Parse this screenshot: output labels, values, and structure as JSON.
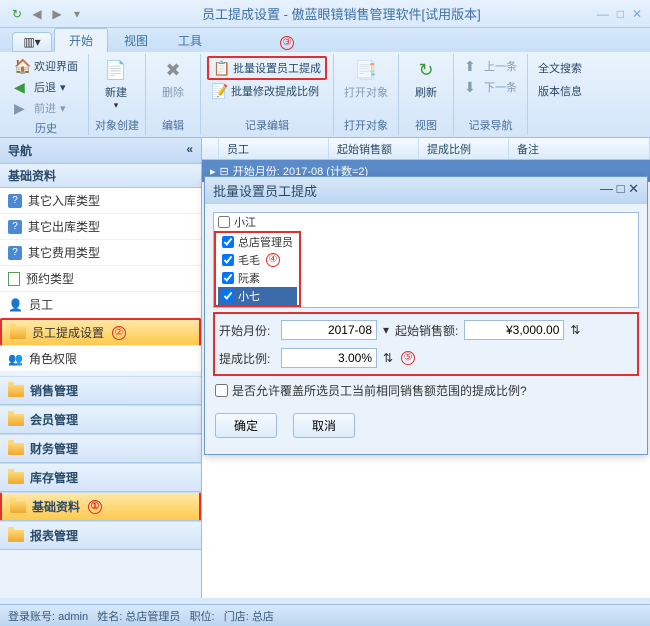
{
  "window": {
    "title": "员工提成设置 - 傲蓝眼镜销售管理软件[试用版本]"
  },
  "ribbon": {
    "tabs": [
      "开始",
      "视图",
      "工具"
    ],
    "history": {
      "welcome": "欢迎界面",
      "back": "后退",
      "forward": "前进",
      "label": "历史"
    },
    "create": {
      "new": "新建",
      "label": "对象创建"
    },
    "edit": {
      "delete": "删除",
      "label": "编辑"
    },
    "record": {
      "batch_set": "批量设置员工提成",
      "batch_edit": "批量修改提成比例",
      "label": "记录编辑"
    },
    "open": {
      "open": "打开对象",
      "label": "打开对象"
    },
    "view": {
      "refresh": "刷新",
      "label": "视图"
    },
    "recnav": {
      "prev": "上一条",
      "next": "下一条",
      "label": "记录导航"
    },
    "search": {
      "full": "全文搜索"
    },
    "version": {
      "info": "版本信息"
    }
  },
  "nav": {
    "title": "导航",
    "section": "基础资料",
    "items": [
      "其它入库类型",
      "其它出库类型",
      "其它费用类型",
      "预约类型",
      "员工",
      "员工提成设置",
      "角色权限"
    ],
    "cats": [
      "销售管理",
      "会员管理",
      "财务管理",
      "库存管理",
      "基础资料",
      "报表管理"
    ]
  },
  "grid": {
    "cols": [
      "员工",
      "起始销售额",
      "提成比例",
      "备注"
    ],
    "grouprow": "开始月份: 2017-08 (计数=2)"
  },
  "dialog": {
    "title": "批量设置员工提成",
    "employees": [
      "小江",
      "总店管理员",
      "毛毛",
      "阮素",
      "小七"
    ],
    "start_month_label": "开始月份:",
    "start_month": "2017-08",
    "start_sales_label": "起始销售额:",
    "start_sales": "¥3,000.00",
    "ratio_label": "提成比例:",
    "ratio": "3.00%",
    "overwrite": "是否允许覆盖所选员工当前相同销售额范围的提成比例?",
    "ok": "确定",
    "cancel": "取消"
  },
  "annot": {
    "1": "①",
    "2": "②",
    "3": "③",
    "4": "④",
    "5": "⑤"
  },
  "status": {
    "account_label": "登录账号:",
    "account": "admin",
    "name_label": "姓名:",
    "name": "总店管理员",
    "pos_label": "职位:",
    "store_label": "门店:",
    "store": "总店"
  }
}
